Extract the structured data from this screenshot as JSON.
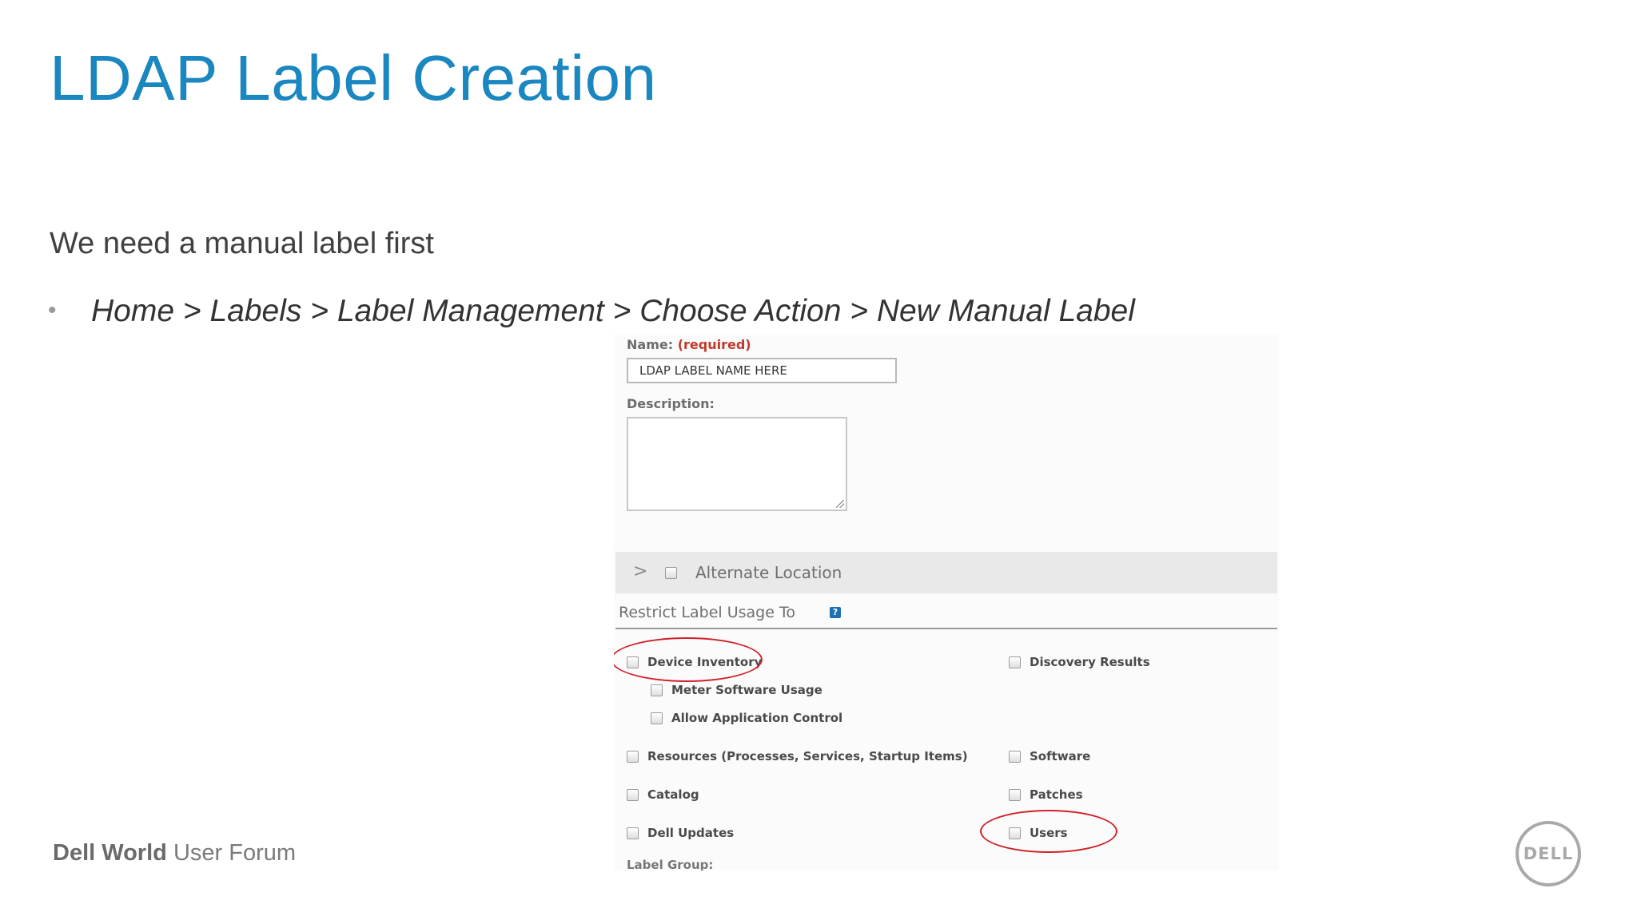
{
  "slide": {
    "title": "LDAP Label Creation",
    "intro": "We need a manual label first",
    "bullet_marker": "•",
    "path": "Home > Labels > Label Management > Choose Action > New Manual Label"
  },
  "form": {
    "name_label": "Name:",
    "name_required": "(required)",
    "name_value": "LDAP LABEL NAME HERE",
    "description_label": "Description:",
    "description_value": "",
    "alternate_chevron": ">",
    "alternate_location": "Alternate Location",
    "restrict_label": "Restrict Label Usage To",
    "help_glyph": "?",
    "options": {
      "device_inventory": "Device Inventory",
      "meter_software_usage": "Meter Software Usage",
      "allow_application_control": "Allow Application Control",
      "resources": "Resources (Processes, Services, Startup Items)",
      "catalog": "Catalog",
      "dell_updates": "Dell Updates",
      "discovery_results": "Discovery Results",
      "software": "Software",
      "patches": "Patches",
      "users": "Users"
    },
    "label_group": "Label Group:",
    "highlight_color": "#d0222a"
  },
  "footer": {
    "brand_bold": "Dell World",
    "brand_rest": "User Forum",
    "logo_text": "DELL"
  },
  "colors": {
    "title": "#1a87c0",
    "text": "#404040"
  }
}
